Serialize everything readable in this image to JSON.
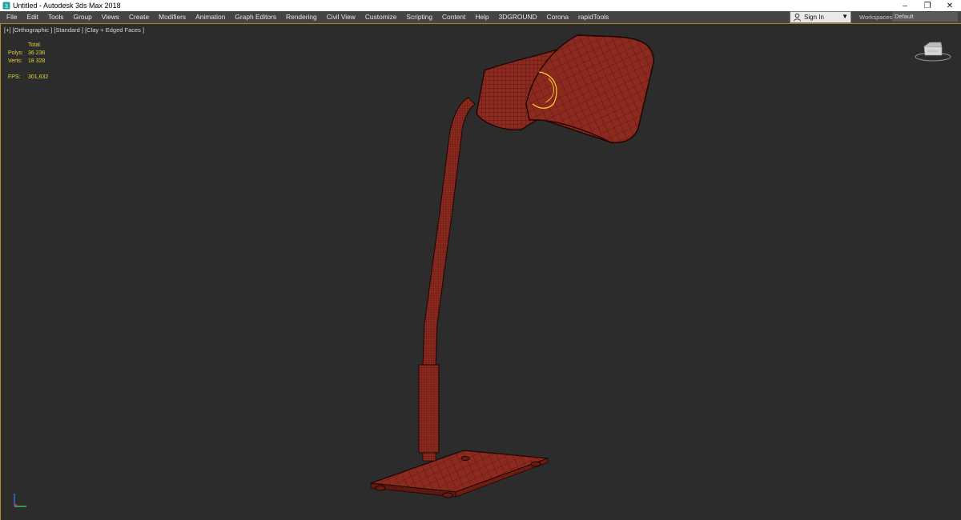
{
  "window": {
    "title": "Untitled - Autodesk 3ds Max 2018",
    "icons": {
      "app": "3dsmax-app-icon",
      "minimize": "minimize-icon",
      "maximize": "restore-icon",
      "close": "close-icon"
    }
  },
  "menubar": {
    "items": [
      "File",
      "Edit",
      "Tools",
      "Group",
      "Views",
      "Create",
      "Modifiers",
      "Animation",
      "Graph Editors",
      "Rendering",
      "Civil View",
      "Customize",
      "Scripting",
      "Content",
      "Help",
      "3DGROUND",
      "Corona",
      "rapidTools"
    ]
  },
  "account": {
    "signin_label": "Sign In"
  },
  "workspaces": {
    "label": "Workspaces:",
    "value": "Default"
  },
  "viewport": {
    "label": "[+] [Orthographic ] [Standard ] [Clay + Edged Faces ]",
    "stats": {
      "header": "Total",
      "polys_label": "Polys:",
      "polys_value": "36 236",
      "verts_label": "Verts:",
      "verts_value": "18 328",
      "fps_label": "FPS:",
      "fps_value": "301,632"
    },
    "colors": {
      "model_fill": "#8c2a1f",
      "model_edges": "#3a0a06",
      "selection": "#ffcc33",
      "stats_text": "#e8d23c",
      "background": "#2c2c2c"
    }
  }
}
